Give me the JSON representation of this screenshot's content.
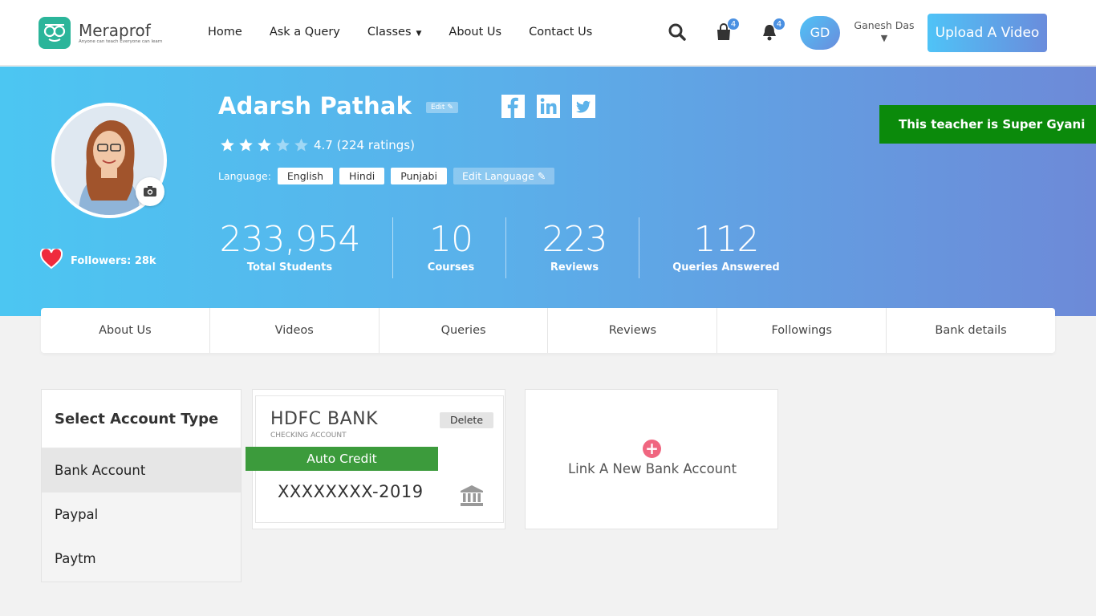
{
  "header": {
    "logo_name": "Meraprof",
    "logo_tagline": "Anyone can teach Everyone can learn",
    "nav": [
      "Home",
      "Ask a Query",
      "Classes",
      "About Us",
      "Contact Us"
    ],
    "cart_badge": "4",
    "notif_badge": "4",
    "user_initials": "GD",
    "user_name": "Ganesh Das",
    "upload_label": "Upload A Video"
  },
  "profile": {
    "name": "Adarsh Pathak",
    "edit_label": "Edit",
    "rating_filled": 3,
    "rating_total": 5,
    "rating_text": "4.7 (224 ratings)",
    "language_label": "Language:",
    "languages": [
      "English",
      "Hindi",
      "Punjabi"
    ],
    "edit_language_label": "Edit Language",
    "followers_text": "Followers: 28k",
    "badge_text": "This teacher is Super Gyani",
    "stats": [
      {
        "num": "233,954",
        "label": "Total Students"
      },
      {
        "num": "10",
        "label": "Courses"
      },
      {
        "num": "223",
        "label": "Reviews"
      },
      {
        "num": "112",
        "label": "Queries Answered"
      }
    ]
  },
  "tabs": [
    "About Us",
    "Videos",
    "Queries",
    "Reviews",
    "Followings",
    "Bank details"
  ],
  "account_panel": {
    "title": "Select Account Type",
    "items": [
      "Bank Account",
      "Paypal",
      "Paytm"
    ],
    "active_index": 0
  },
  "bank_card": {
    "name": "HDFC BANK",
    "type": "CHECKING ACCOUNT",
    "delete_label": "Delete",
    "auto_credit_label": "Auto Credit",
    "account_number": "XXXXXXXX-2019"
  },
  "link_card": {
    "plus": "+",
    "text": "Link A New Bank Account"
  },
  "colors": {
    "brand_green": "#2bb59a",
    "banner_start": "#4cc6f2",
    "banner_end": "#6d8ad8",
    "gyani_green": "#0b8a0b",
    "auto_credit_green": "#3c9b3c",
    "plus_pink": "#f06680"
  }
}
